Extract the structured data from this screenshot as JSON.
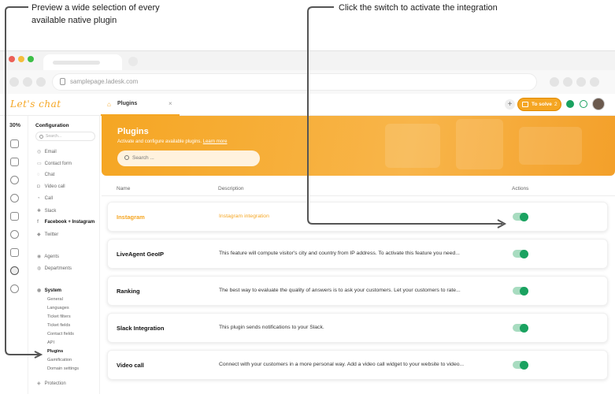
{
  "annotations": {
    "left": "Preview a wide selection of every available native plugin",
    "right": "Click the switch to activate the integration"
  },
  "browser": {
    "url": "samplepage.ladesk.com",
    "traffic_lights": [
      "#ec5f56",
      "#f5bd3b",
      "#3dbf47"
    ]
  },
  "app": {
    "logo": "Let's chat",
    "tab_label": "Plugins",
    "tab_close": "×",
    "add_label": "+",
    "to_solve_label": "To solve",
    "to_solve_count": "2",
    "accent": "#f5a623"
  },
  "rail": {
    "percent": "30%",
    "icons": [
      "dashboard-icon",
      "mail-icon",
      "chat-icon",
      "phone-icon",
      "reports-icon",
      "contacts-icon",
      "knowledgebase-icon",
      "settings-icon",
      "heart-icon"
    ]
  },
  "config": {
    "title": "Configuration",
    "search_placeholder": "Search...",
    "items": [
      {
        "icon": "◎",
        "label": "Email"
      },
      {
        "icon": "▭",
        "label": "Contact form"
      },
      {
        "icon": "◌",
        "label": "Chat"
      },
      {
        "icon": "◘",
        "label": "Video call"
      },
      {
        "icon": "◔",
        "label": "Call"
      },
      {
        "icon": "✱",
        "label": "Slack"
      },
      {
        "icon": "f",
        "label": "Facebook + Instagram"
      },
      {
        "icon": "◆",
        "label": "Twitter"
      }
    ],
    "agents": {
      "icon": "◉",
      "label": "Agents"
    },
    "departments": {
      "icon": "◍",
      "label": "Departments"
    },
    "system": {
      "icon": "◉",
      "label": "System"
    },
    "system_items": [
      "General",
      "Languages",
      "Ticket filters",
      "Ticket fields",
      "Contact fields",
      "API",
      "Plugins",
      "Gamification",
      "Domain settings"
    ],
    "protection": {
      "icon": "◈",
      "label": "Protection"
    }
  },
  "main": {
    "title": "Plugins",
    "subtitle": "Activate and configure available plugins.",
    "learn_more": "Learn more",
    "search_placeholder": "Search ...",
    "columns": {
      "name": "Name",
      "description": "Description",
      "actions": "Actions"
    },
    "rows": [
      {
        "name": "Instagram",
        "description": "Instagram integration",
        "enabled": true
      },
      {
        "name": "LiveAgent GeoIP",
        "description": "This feature will compute visitor's city and country from IP address. To activate this feature you need...",
        "enabled": true
      },
      {
        "name": "Ranking",
        "description": "The best way to evaluate the quality of answers is to ask your customers. Let your customers to rate...",
        "enabled": true
      },
      {
        "name": "Slack Integration",
        "description": "This plugin sends notifications to your Slack.",
        "enabled": true
      },
      {
        "name": "Video call",
        "description": "Connect with your customers in a more personal way. Add a video call widget to your website to video...",
        "enabled": true
      }
    ]
  }
}
